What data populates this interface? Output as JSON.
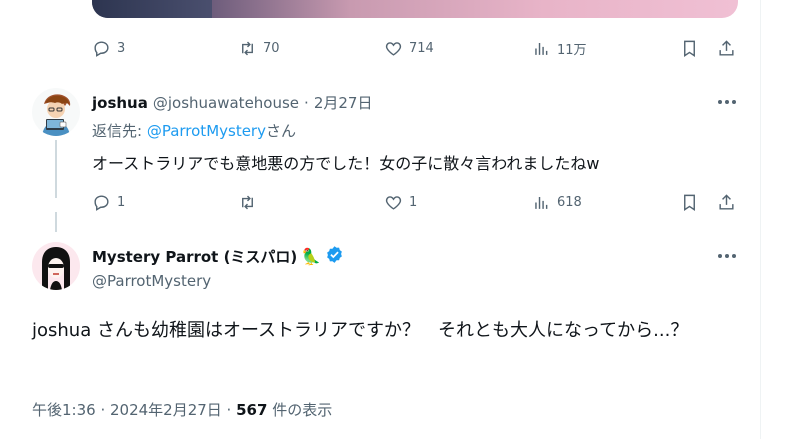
{
  "top_post": {
    "stats": {
      "replies": "3",
      "reposts": "70",
      "likes": "714",
      "views": "11万"
    }
  },
  "reply": {
    "display_name": "joshua",
    "handle": "@joshuawatehouse",
    "separator": "·",
    "date": "2月27日",
    "reply_to_prefix": "返信先: ",
    "reply_to_handle": "@ParrotMystery",
    "reply_to_suffix": "さん",
    "text": "オーストラリアでも意地悪の方でした！女の子に散々言われましたねw",
    "stats": {
      "replies": "1",
      "reposts": "",
      "likes": "1",
      "views": "618"
    }
  },
  "main_post": {
    "display_name": "Mystery Parrot (ミスパロ)",
    "parrot_emoji": "🦜",
    "handle": "@ParrotMystery",
    "text": "joshua さんも幼稚園はオーストラリアですか？　それとも大人になってから...？",
    "time": "午後1:36 · 2024年2月27日 · ",
    "views_count": "567",
    "views_label": " 件の表示"
  },
  "colors": {
    "accent": "#1d9bf0",
    "muted": "#536471",
    "thread_line": "#cfd9de"
  },
  "icons": [
    "reply-icon",
    "repost-icon",
    "like-icon",
    "views-icon",
    "bookmark-icon",
    "share-icon",
    "more-icon",
    "verified-badge-icon"
  ]
}
